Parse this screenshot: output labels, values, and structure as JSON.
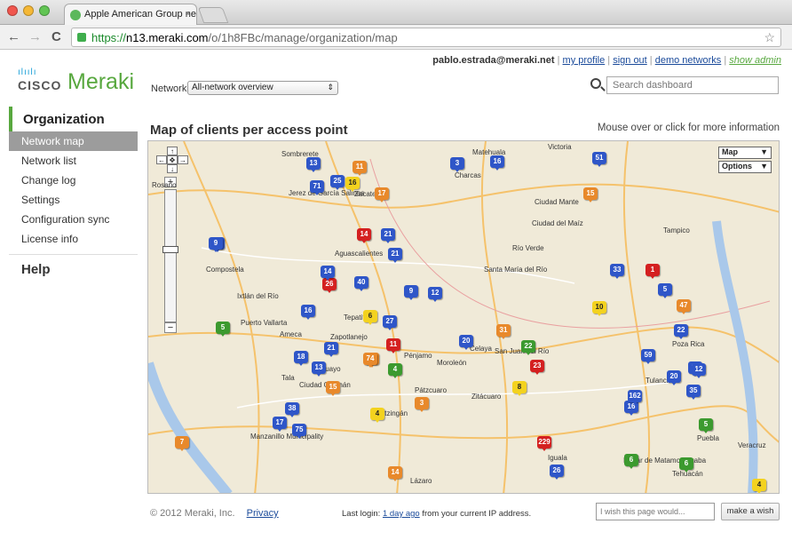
{
  "browser": {
    "tab_title": "Apple American Group netw",
    "tab_close": "×",
    "url_scheme": "https://",
    "url_domain": "n13.meraki.com",
    "url_path": "/o/1h8FBc/manage/organization/map",
    "back": "←",
    "forward": "→",
    "reload": "C",
    "star": "☆"
  },
  "logo": {
    "bars": "ılıılı",
    "cisco": "CISCO",
    "meraki": "Meraki"
  },
  "header": {
    "email": "pablo.estrada@meraki.net",
    "separator": "|",
    "links": [
      "my profile",
      "sign out",
      "demo networks"
    ],
    "admin_link": "show admin",
    "network_label": "Network:",
    "network_value": "All-network overview",
    "search_placeholder": "Search dashboard"
  },
  "sidebar": {
    "section_organization": "Organization",
    "items": [
      "Network map",
      "Network list",
      "Change log",
      "Settings",
      "Configuration sync",
      "License info"
    ],
    "active_index": 0,
    "section_help": "Help"
  },
  "main": {
    "title": "Map of clients per access point",
    "hint": "Mouse over or click for more information",
    "map_type": "Map",
    "map_options": "Options",
    "cities": [
      "Victoria",
      "Matehuala",
      "Charcas",
      "Rosario",
      "Sombrerete",
      "Jerez de García Salinas",
      "Zacatecas",
      "Ciudad Mante",
      "Ciudad del Maíz",
      "Tampico",
      "Aguascalientes",
      "Río Verde",
      "Santa María del Río",
      "Compostela",
      "Ixtlán del Río",
      "Puerto Vallarta",
      "Ameca",
      "Zapotlanejo",
      "Tepatitlán",
      "Pénjamo",
      "Moroleón",
      "Celaya",
      "San Juan del Río",
      "Tulancingo",
      "Poza Rica",
      "Manzanillo Municipality",
      "Apatzingán",
      "Pátzcuaro",
      "Zitácuaro",
      "Iguala",
      "Izúcar de Matamoros",
      "Orizaba",
      "Veracruz",
      "Tehuacán",
      "Lázaro",
      "Ciudad Guzmán",
      "Tala",
      "Sahuayo",
      "Puebla"
    ]
  },
  "pins": {
    "labels": [
      "13",
      "11",
      "71",
      "25",
      "16",
      "17",
      "3",
      "16",
      "51",
      "15",
      "9",
      "14",
      "21",
      "21",
      "40",
      "26",
      "14",
      "9",
      "33",
      "1",
      "5",
      "47",
      "16",
      "6",
      "27",
      "12",
      "11",
      "10",
      "5",
      "22",
      "9",
      "20",
      "31",
      "22",
      "11",
      "21",
      "18",
      "13",
      "74",
      "4",
      "23",
      "59",
      "12",
      "20",
      "35",
      "16",
      "8",
      "15",
      "162",
      "12",
      "4",
      "38",
      "75",
      "17",
      "229",
      "26",
      "6",
      "14",
      "5",
      "6",
      "4",
      "3",
      "7"
    ],
    "colors": {
      "blue": "#2f56c8",
      "orange": "#e8892b",
      "red": "#d42020",
      "green": "#3c9a2f",
      "yellow": "#f3d21f",
      "pink": "#f3a8b8",
      "black": "#222222"
    }
  },
  "footer": {
    "copyright": "© 2012 Meraki, Inc.",
    "privacy": "Privacy",
    "last_login_prefix": "Last login:",
    "last_login_link": "1 day ago",
    "last_login_suffix": "from your current IP address.",
    "wish_placeholder": "I wish this page would...",
    "wish_button": "make a wish"
  }
}
